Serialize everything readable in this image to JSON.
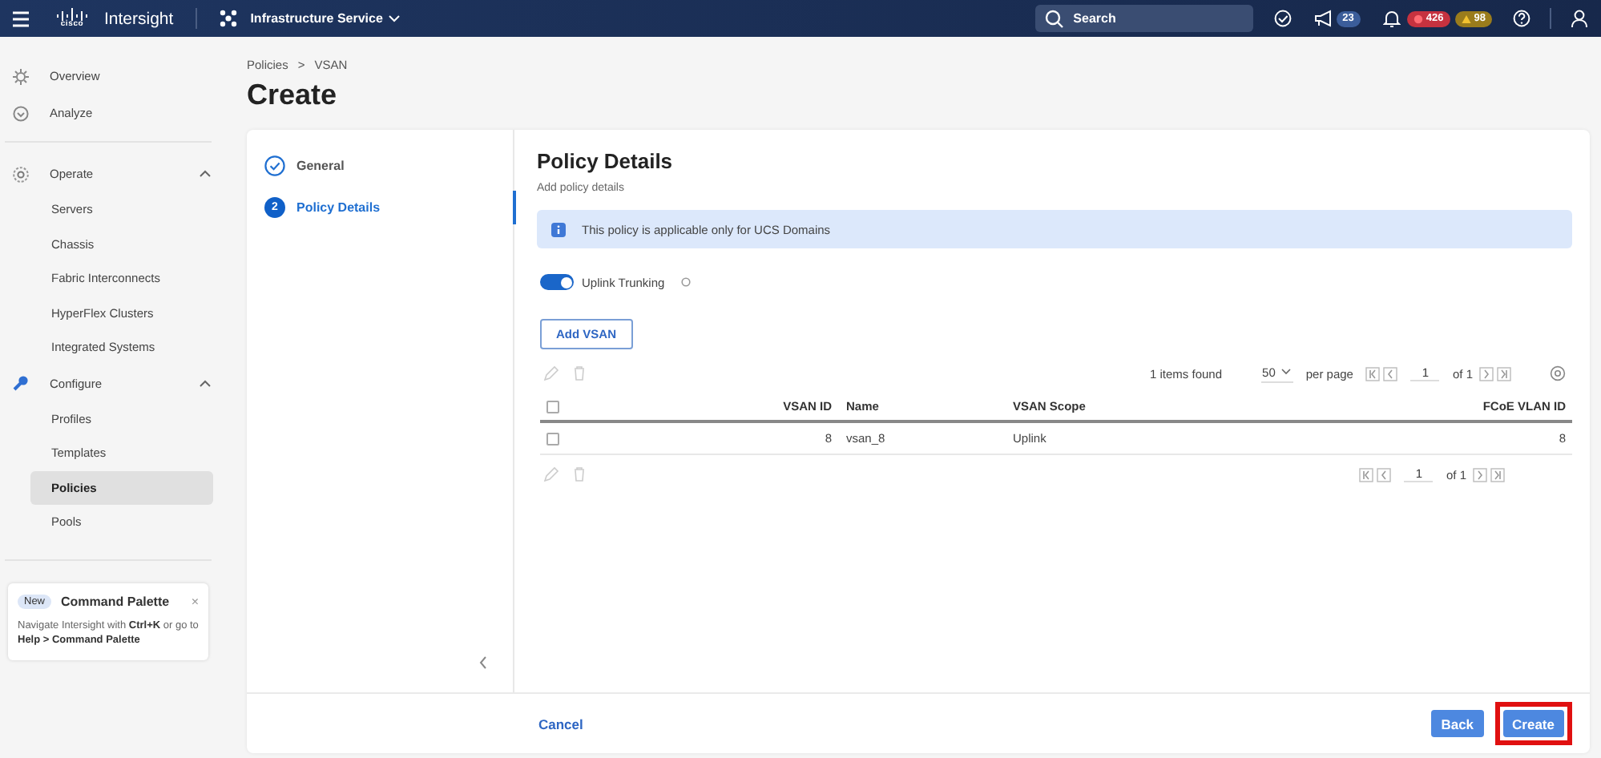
{
  "header": {
    "logo_text": "cisco",
    "product": "Intersight",
    "service": "Infrastructure Service",
    "search": {
      "placeholder": "Search"
    },
    "announcements": "23",
    "alarms": [
      {
        "count": "426",
        "color": "#c6323f",
        "kind": "critical"
      },
      {
        "count": "98",
        "color": "#9a7c1c",
        "kind": "warning"
      }
    ]
  },
  "sidebar": {
    "items": [
      {
        "label": "Overview",
        "selected": false
      },
      {
        "label": "Analyze",
        "selected": false
      },
      {
        "label": "Operate",
        "expanded": true,
        "children": [
          {
            "label": "Servers",
            "selected": false
          },
          {
            "label": "Chassis",
            "selected": false
          },
          {
            "label": "Fabric Interconnects",
            "selected": false
          },
          {
            "label": "HyperFlex Clusters",
            "selected": false
          },
          {
            "label": "Integrated Systems",
            "selected": false
          }
        ]
      },
      {
        "label": "Configure",
        "expanded": true,
        "children": [
          {
            "label": "Profiles",
            "selected": false
          },
          {
            "label": "Templates",
            "selected": false
          },
          {
            "label": "Policies",
            "selected": true
          },
          {
            "label": "Pools",
            "selected": false
          }
        ]
      }
    ],
    "command_palette": {
      "badge": "New",
      "title": "Command Palette",
      "close": "×",
      "text": "Navigate Intersight with **Ctrl+K** or go to **Help > Command Palette**"
    }
  },
  "breadcrumb": {
    "items": [
      "Policies",
      "VSAN"
    ],
    "separator": ">"
  },
  "title": "Create",
  "steps": [
    {
      "label": "General",
      "done": true,
      "selected": false
    },
    {
      "number": "2",
      "label": "Policy Details",
      "done": false,
      "selected": true
    }
  ],
  "panel": {
    "title": "Policy Details",
    "subtitle": "Add policy details",
    "info": "This policy is applicable only for UCS Domains",
    "toggle": {
      "label": "Uplink Trunking",
      "on": true
    },
    "add_button": "Add VSAN",
    "table": {
      "items_found": "1 items found",
      "page_size": "50",
      "per_page": "per page",
      "page": "1",
      "page_of": "of 1",
      "all_checked": false,
      "columns": [
        "VSAN ID",
        "Name",
        "VSAN Scope",
        "FCoE VLAN ID"
      ],
      "rows": [
        {
          "cells": [
            "8",
            "vsan_8",
            "Uplink",
            "8"
          ],
          "checked": false
        }
      ],
      "bottom_page": "1",
      "bottom_page_of": "of 1"
    }
  },
  "footer": {
    "cancel": "Cancel",
    "back": "Back",
    "create": "Create",
    "create_highlighted": true
  }
}
